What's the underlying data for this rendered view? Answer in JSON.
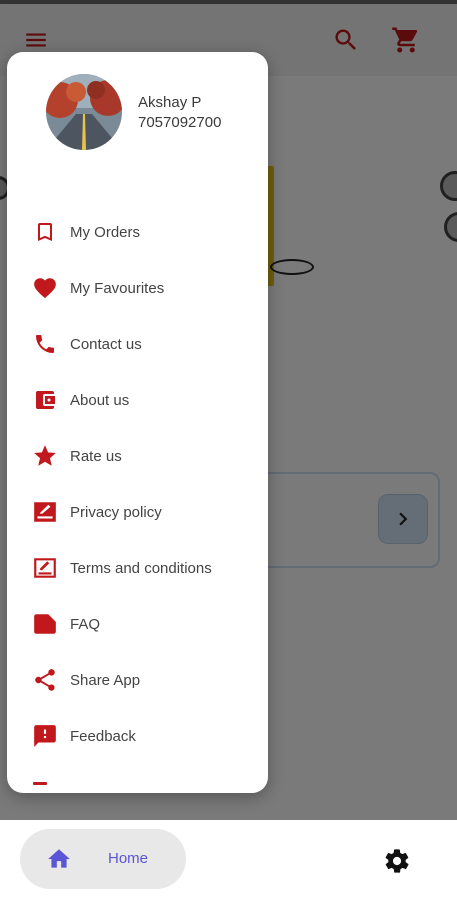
{
  "user": {
    "name": "Akshay P",
    "phone": "7057092700"
  },
  "drawer": {
    "items": [
      {
        "label": "My Orders",
        "icon": "bookmark-icon"
      },
      {
        "label": "My Favourites",
        "icon": "heart-icon"
      },
      {
        "label": "Contact us",
        "icon": "phone-icon"
      },
      {
        "label": "About us",
        "icon": "wallet-icon"
      },
      {
        "label": "Rate us",
        "icon": "star-icon"
      },
      {
        "label": "Privacy policy",
        "icon": "edit-signature-icon"
      },
      {
        "label": "Terms and conditions",
        "icon": "signature-box-icon"
      },
      {
        "label": "FAQ",
        "icon": "label-icon"
      },
      {
        "label": "Share App",
        "icon": "share-icon"
      },
      {
        "label": "Feedback",
        "icon": "feedback-icon"
      }
    ]
  },
  "bottom_nav": {
    "home_label": "Home",
    "home_icon": "home-icon",
    "settings_icon": "gear-icon"
  },
  "colors": {
    "accent": "#c0181c",
    "nav_active": "#5a55d6",
    "scrim": "rgba(0,0,0,0.52)"
  }
}
